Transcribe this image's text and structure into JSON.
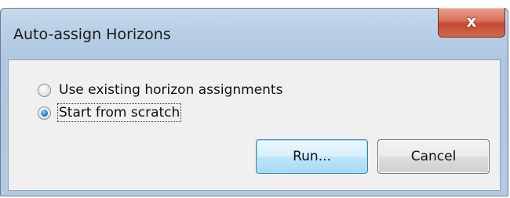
{
  "window": {
    "title": "Auto-assign Horizons",
    "close_glyph": "x"
  },
  "options": [
    {
      "label": "Use existing horizon assignments",
      "selected": false
    },
    {
      "label": "Start from scratch",
      "selected": true
    }
  ],
  "buttons": {
    "run_label": "Run...",
    "cancel_label": "Cancel"
  },
  "colors": {
    "title_bar": "#b9cfe6",
    "close_button": "#c24b32",
    "client_background": "#f0f0f0",
    "default_button_border": "#3c7fb1"
  },
  "icons": {
    "close": "close-icon",
    "radio": "radio-button-icon"
  }
}
